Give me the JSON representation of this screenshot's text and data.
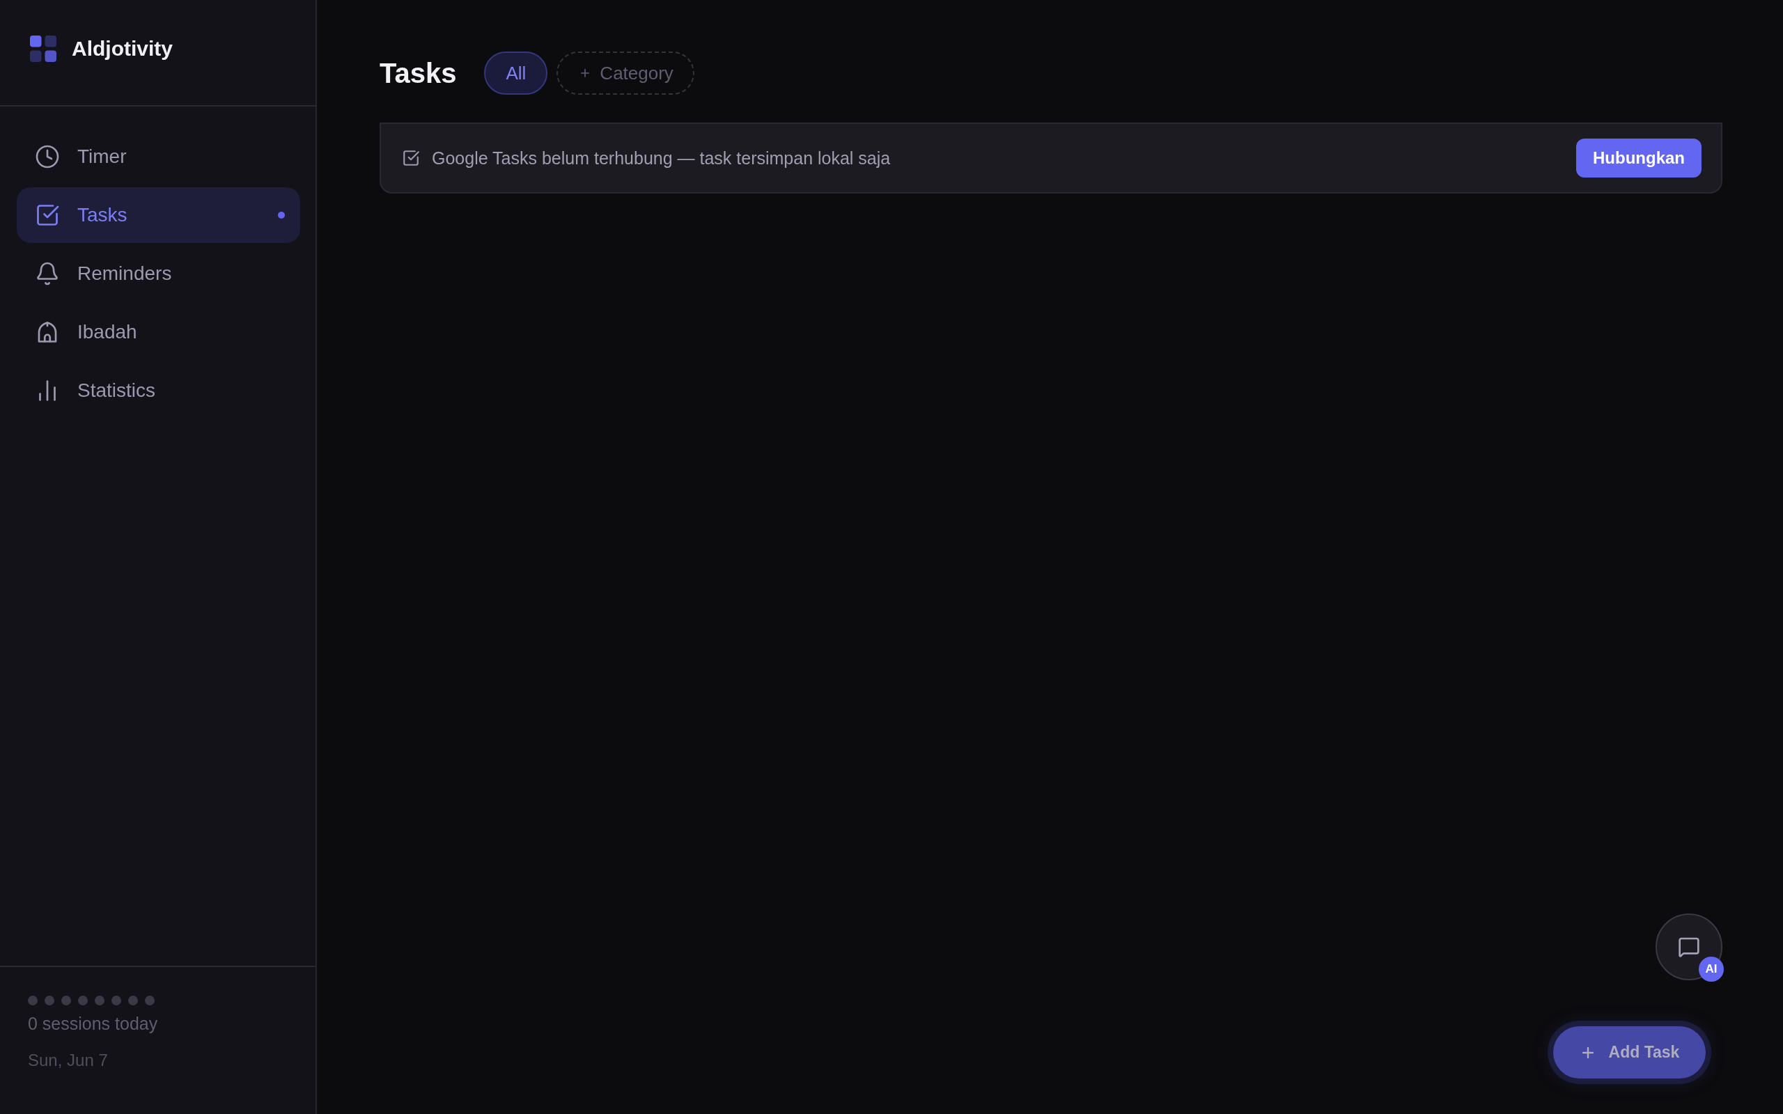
{
  "sidebar": {
    "app_name": "Aldjotivity",
    "nav": [
      {
        "label": "Timer",
        "selected": false
      },
      {
        "label": "Tasks",
        "selected": true
      },
      {
        "label": "Reminders",
        "selected": false
      },
      {
        "label": "Ibadah",
        "selected": false
      },
      {
        "label": "Statistics",
        "selected": false
      }
    ],
    "session_dots": [
      {
        "done": false
      },
      {
        "done": false
      },
      {
        "done": false
      },
      {
        "done": false
      },
      {
        "done": false
      },
      {
        "done": false
      },
      {
        "done": false
      },
      {
        "done": false
      }
    ],
    "sessions_text": "0 sessions today",
    "date": "Sun, Jun 7"
  },
  "header": {
    "title": "Tasks",
    "filters": [
      {
        "label": "All",
        "selected": true
      }
    ],
    "add_category": "Category"
  },
  "banner": {
    "message": "Google Tasks belum terhubung — task tersimpan lokal saja",
    "button": "Hubungkan"
  },
  "chat_button": {
    "badge": "AI"
  },
  "add_task_button": {
    "label": "Add Task"
  }
}
